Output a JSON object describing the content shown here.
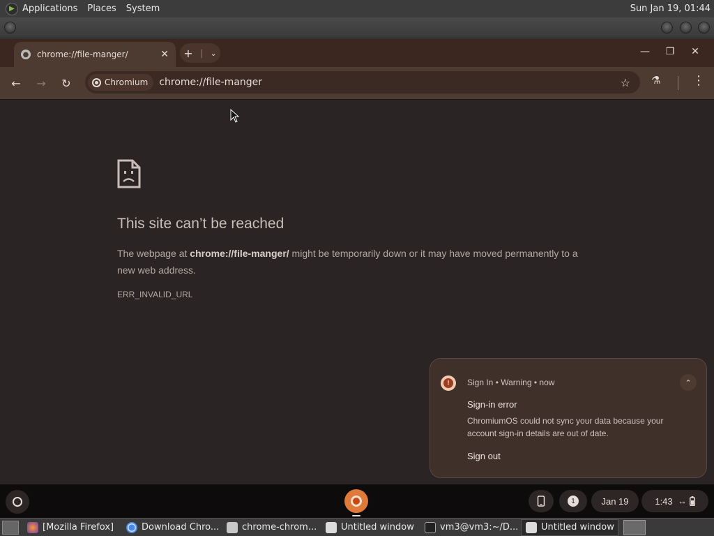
{
  "top_panel": {
    "menus": [
      "Applications",
      "Places",
      "System"
    ],
    "clock": "Sun Jan 19, 01:44"
  },
  "browser": {
    "tab": {
      "title": "chrome://file-manger/"
    },
    "omnibox": {
      "chip_label": "Chromium",
      "url": "chrome://file-manger"
    }
  },
  "error_page": {
    "title": "This site can’t be reached",
    "desc_prefix": "The webpage at ",
    "desc_url": "chrome://file-manger/",
    "desc_suffix": " might be temporarily down or it may have moved permanently to a new web address.",
    "code": "ERR_INVALID_URL"
  },
  "notification": {
    "source": "Sign In",
    "category": "Warning",
    "time": "now",
    "title": "Sign-in error",
    "body": "ChromiumOS could not sync your data because your account sign-in details are out of date.",
    "action": "Sign out"
  },
  "shelf": {
    "notification_count": "1",
    "date": "Jan 19",
    "time": "1:43"
  },
  "taskbar": {
    "tasks": [
      "[Mozilla Firefox]",
      "Download Chro...",
      "chrome-chrom...",
      "Untitled window",
      "vm3@vm3:~/D...",
      "Untitled window"
    ]
  },
  "colors": {
    "accent": "#e07a3a",
    "warning": "#9a3e1f",
    "background": "#2a2424"
  }
}
